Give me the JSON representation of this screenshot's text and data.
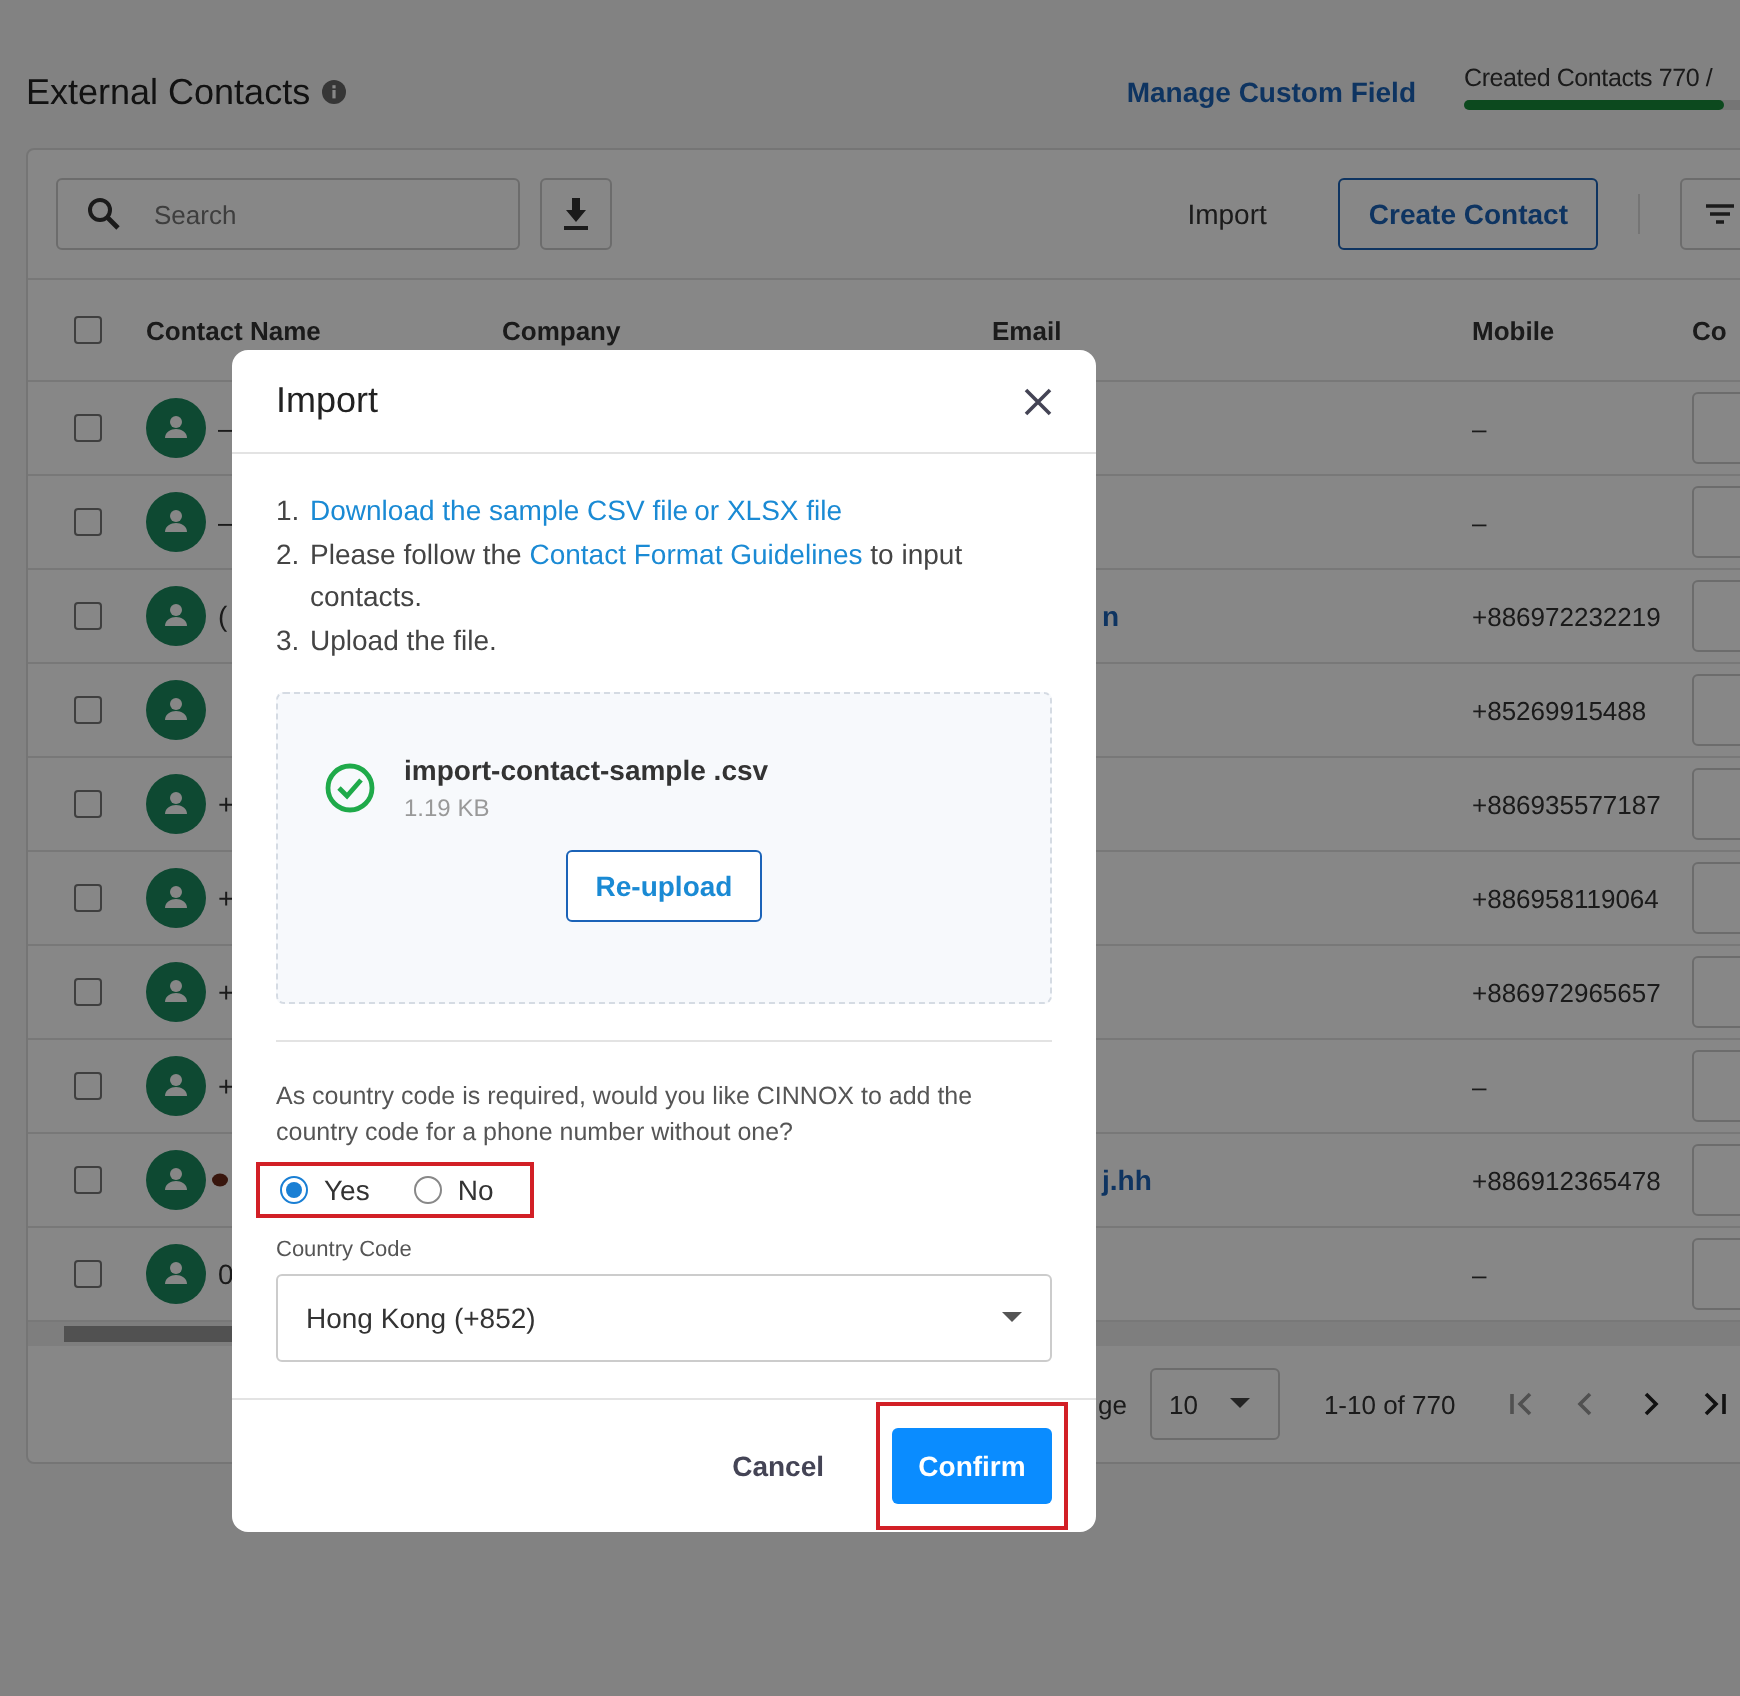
{
  "page": {
    "title": "External Contacts",
    "manage_link": "Manage Custom Field",
    "quota": {
      "label": "Created Contacts 770 /",
      "level": 0.93
    }
  },
  "toolbar": {
    "search_placeholder": "Search",
    "import": "Import",
    "create": "Create Contact"
  },
  "table": {
    "select_all": {
      "checked": false
    },
    "columns": [
      "Contact Name",
      "Company",
      "Email",
      "Mobile",
      "Co"
    ],
    "rows": [
      {
        "checked": false,
        "name": "–",
        "mobile": "–"
      },
      {
        "checked": false,
        "name": "–",
        "mobile": "–"
      },
      {
        "checked": false,
        "name": "(",
        "email": "n",
        "mobile": "+886972232219"
      },
      {
        "checked": false,
        "mobile": "+85269915488"
      },
      {
        "checked": false,
        "name": "+",
        "mobile": "+886935577187"
      },
      {
        "checked": false,
        "name": "+",
        "mobile": "+886958119064"
      },
      {
        "checked": false,
        "name": "+",
        "mobile": "+886972965657"
      },
      {
        "checked": false,
        "name": "+",
        "mobile": "–"
      },
      {
        "checked": false,
        "emoji": true,
        "email": "j.hh",
        "mobile": "+886912365478"
      },
      {
        "checked": false,
        "name": "0",
        "mobile": "–"
      }
    ]
  },
  "pagination": {
    "rows_label": "ge",
    "page_size": "10",
    "range": "1-10 of 770"
  },
  "dialog": {
    "title": "Import",
    "steps": [
      {
        "number": "1.",
        "parts": [
          {
            "text": "Download the sample CSV file",
            "link": true
          },
          {
            "text": "or XLSX file",
            "link": true
          }
        ]
      },
      {
        "number": "2.",
        "parts": [
          {
            "text": "Please follow the "
          },
          {
            "text": "Contact Format Guidelines",
            "link": true
          },
          {
            "text": " to input contacts."
          }
        ]
      },
      {
        "number": "3.",
        "parts": [
          {
            "text": "Upload the file."
          }
        ]
      }
    ],
    "file": {
      "name": "import-contact-sample .csv",
      "size": "1.19 KB",
      "uploaded": true,
      "button": "Re-upload"
    },
    "question": "As country code is required, would you like CINNOX to add the country code for a phone number without one?",
    "radios": {
      "highlighted": true,
      "options": [
        {
          "label": "Yes",
          "selected": true
        },
        {
          "label": "No",
          "selected": false
        }
      ]
    },
    "country_code": {
      "label": "Country Code",
      "value": "Hong Kong (+852)"
    },
    "cancel": "Cancel",
    "confirm": {
      "label": "Confirm",
      "highlighted": true
    }
  }
}
